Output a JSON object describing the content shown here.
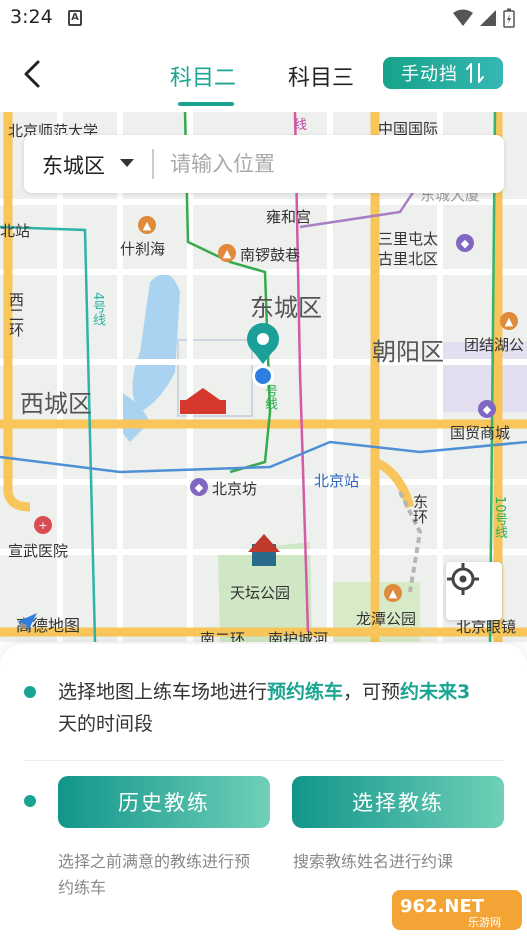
{
  "status_bar": {
    "time": "3:24",
    "notif_letter": "A"
  },
  "nav": {
    "tabs": [
      {
        "label": "科目二",
        "active": true
      },
      {
        "label": "科目三",
        "active": false
      }
    ],
    "transmission_label": "手动挡"
  },
  "search": {
    "district": "东城区",
    "placeholder": "请输入位置"
  },
  "map": {
    "labels": {
      "bnu": "北京师范大学",
      "zhongguo_guoji": "中国国际",
      "xi_zhimen_station": "北站",
      "yonghegong": "雍和宫",
      "shichahai": "什刹海",
      "nanluoguxiang": "南锣鼓巷",
      "sanlitun": "三里屯太",
      "gulibei": "古里北区",
      "dongcheng": "东城区",
      "chaoyang": "朝阳区",
      "tuanjiehu": "团结湖公",
      "xicheng": "西城区",
      "guomao": "国贸商城",
      "beijingzhan": "北京站",
      "beijingfang": "北京坊",
      "xuanwu": "宣武医院",
      "tiantan": "天坛公园",
      "longtan": "龙潭公园",
      "beijingyanjing": "北京眼镜",
      "nanerhuan": "南二环",
      "nanhuchenghe": "南护城河",
      "dong_huan": "东环",
      "xi_erhuan": "西二环",
      "line4": "4号线",
      "line5_top": "线",
      "line5": "号线",
      "line10": "10号线",
      "dongzhimen_top": "东城大厦"
    },
    "logo_text": "高德地图"
  },
  "panel": {
    "tip_line1_a": "选择地图上练车场地进行",
    "tip_line1_hl1": "预约练车",
    "tip_line1_b": "，可预",
    "tip_line1_hl2": "约未来3",
    "tip_line2": "天的时间段",
    "history_button": "历史教练",
    "choose_button": "选择教练",
    "history_desc_1": "选择之前满意的教练进行预",
    "history_desc_2": "约练车",
    "choose_desc": "搜索教练姓名进行约课"
  },
  "watermark": {
    "text": "962.NET",
    "sub": "乐游网"
  },
  "colors": {
    "accent": "#1aa592",
    "button_start": "#12958a",
    "button_end": "#6fd0b8"
  }
}
